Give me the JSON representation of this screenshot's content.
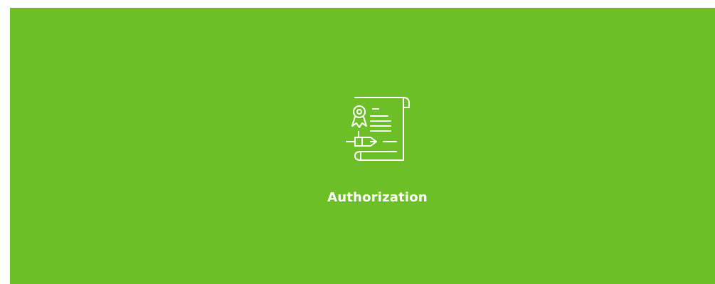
{
  "tile": {
    "label": "Authorization",
    "background_color": "#6dbf27",
    "icon": "certificate-with-pen-icon"
  }
}
